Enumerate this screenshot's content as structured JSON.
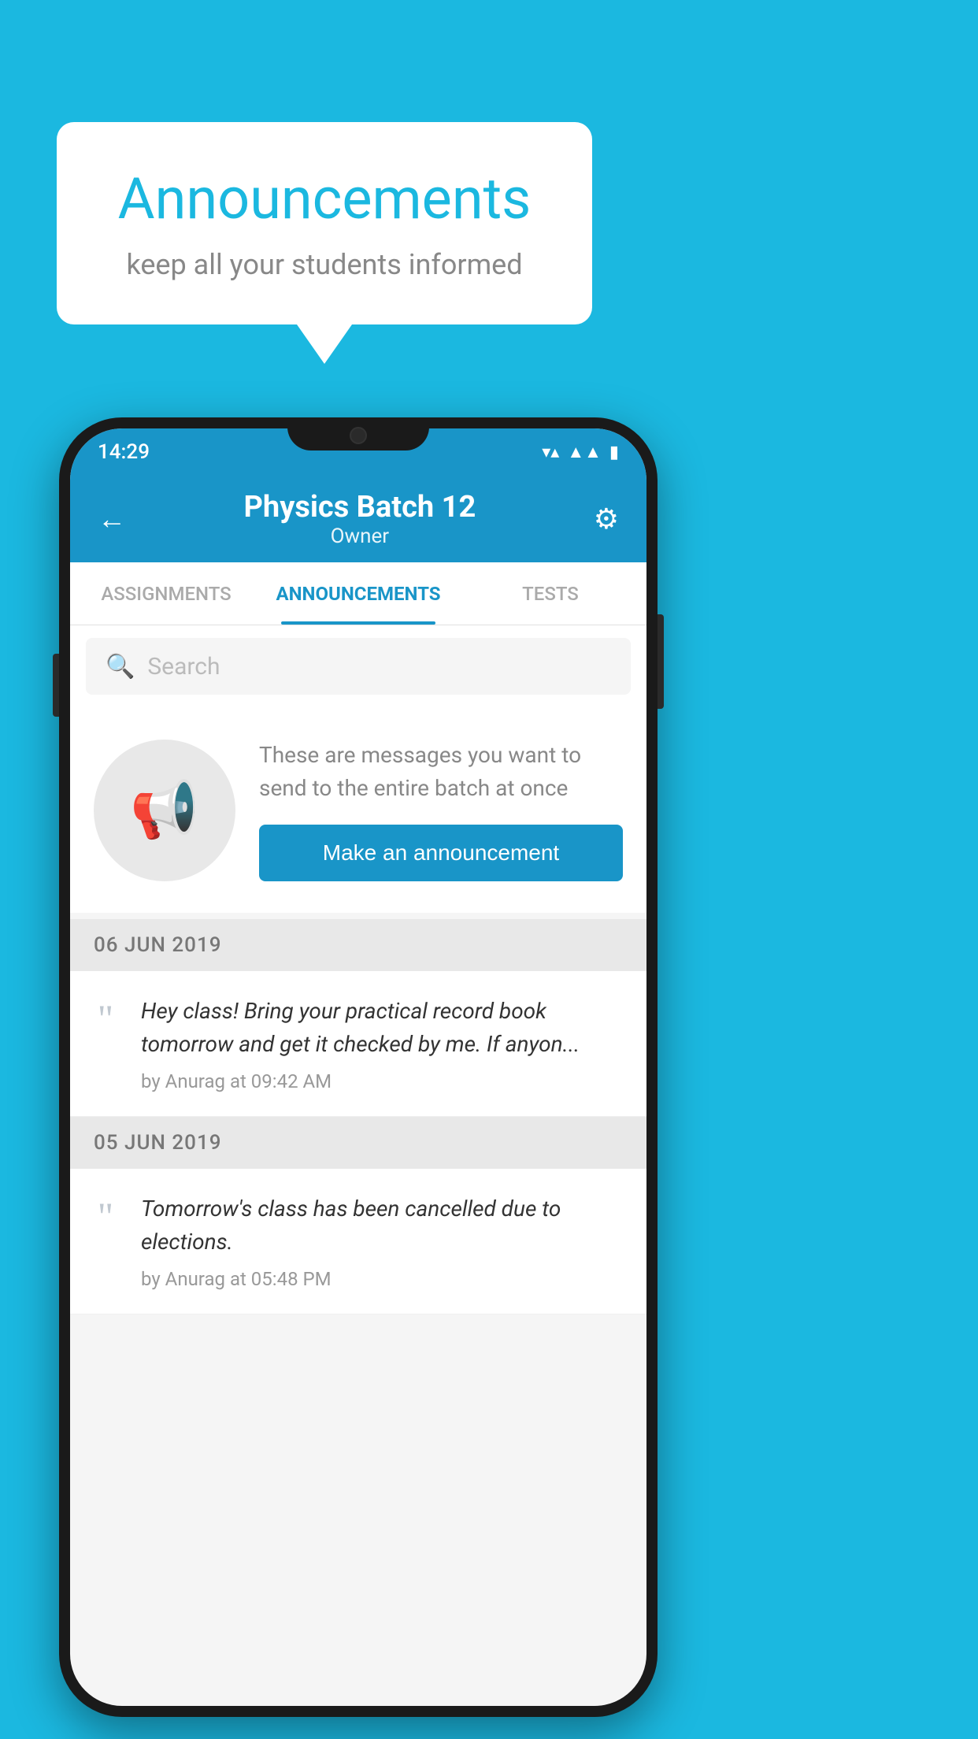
{
  "background": {
    "color": "#1BB8E0"
  },
  "speech_bubble": {
    "title": "Announcements",
    "subtitle": "keep all your students informed"
  },
  "phone": {
    "status_bar": {
      "time": "14:29",
      "wifi": "▼",
      "signal": "▲",
      "battery": "▮"
    },
    "header": {
      "back_label": "←",
      "title": "Physics Batch 12",
      "subtitle": "Owner",
      "settings_label": "⚙"
    },
    "tabs": [
      {
        "label": "ASSIGNMENTS",
        "active": false
      },
      {
        "label": "ANNOUNCEMENTS",
        "active": true
      },
      {
        "label": "TESTS",
        "active": false
      }
    ],
    "search": {
      "placeholder": "Search"
    },
    "promo": {
      "description": "These are messages you want to send to the entire batch at once",
      "button_label": "Make an announcement"
    },
    "announcements": [
      {
        "date": "06  JUN  2019",
        "text": "Hey class! Bring your practical record book tomorrow and get it checked by me. If anyon...",
        "meta": "by Anurag at 09:42 AM"
      },
      {
        "date": "05  JUN  2019",
        "text": "Tomorrow's class has been cancelled due to elections.",
        "meta": "by Anurag at 05:48 PM"
      }
    ]
  }
}
